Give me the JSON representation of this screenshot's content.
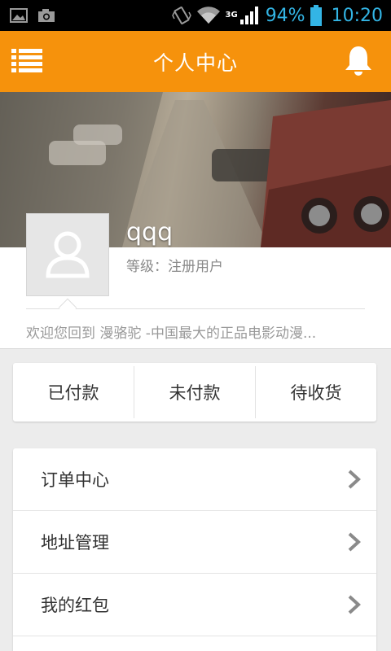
{
  "status_bar": {
    "network_type": "3G",
    "battery_percent": "94%",
    "time": "10:20",
    "icons": [
      "image-icon",
      "camera-icon",
      "vibrate-icon",
      "wifi-icon",
      "signal-icon",
      "battery-icon"
    ]
  },
  "header": {
    "title": "个人中心",
    "menu_icon": "list-menu-icon",
    "notification_icon": "bell-icon",
    "color": "#f6920c"
  },
  "profile": {
    "username": "qqq",
    "level": "等级：注册用户",
    "welcome": "欢迎您回到 漫骆驼 -中国最大的正品电影动漫...",
    "avatar_icon": "user-avatar-icon"
  },
  "payment_tabs": [
    {
      "label": "已付款"
    },
    {
      "label": "未付款"
    },
    {
      "label": "待收货"
    }
  ],
  "menu_items": [
    {
      "label": "订单中心"
    },
    {
      "label": "地址管理"
    },
    {
      "label": "我的红包"
    }
  ]
}
